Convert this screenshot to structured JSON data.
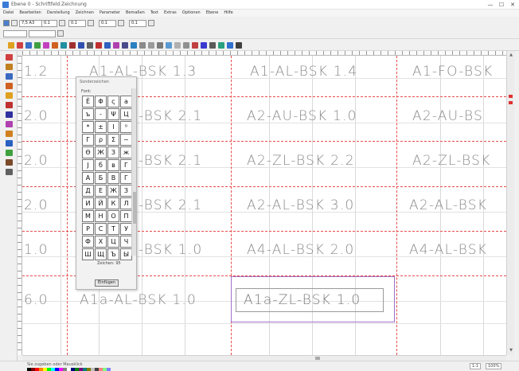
{
  "window": {
    "title": "Ebene 0 - Schriftfeld.Zeichnung",
    "controls": [
      "—",
      "☐",
      "✕"
    ]
  },
  "menu": [
    "Datei",
    "Bearbeiten",
    "Darstellung",
    "Zeichnen",
    "Parameter",
    "Bemaßen",
    "Text",
    "Extras",
    "Optionen",
    "Ebene",
    "Hilfe"
  ],
  "toolbar": {
    "layer_value": "7,5 A3",
    "fields": [
      "0.1",
      "0.1",
      "0.1",
      "0.1"
    ]
  },
  "canvas": {
    "rows": [
      {
        "c0": "1.2",
        "c1": "A1-AL-BSK 1.3",
        "c2": "A1-AL-BSK 1.4",
        "c3": "A1-FO-BSK"
      },
      {
        "c0": "2.0",
        "c1": "-BSK 2.1",
        "c2": "A2-AU-BSK 1.0",
        "c3": "A2-AU-BS"
      },
      {
        "c0": "2.0",
        "c1": "-BSK 2.1",
        "c2": "A2-ZL-BSK 2.2",
        "c3": "A2-ZL-BSK"
      },
      {
        "c0": "2.0",
        "c1": "-BSK 2.1",
        "c2": "A2-AL-BSK 3.0",
        "c3": "A2-AL-BSK"
      },
      {
        "c0": "1.0",
        "c1": "-BSK 1.0",
        "c2": "A4-AL-BSK 2.0",
        "c3": "A4-AL-BSK"
      },
      {
        "c0": "6.0",
        "c1": "A1a-AL-BSK 1.0",
        "c2": "A1a-ZL-BSK 1.0",
        "c3": ""
      }
    ],
    "selected_text": "A1a-ZL-BSK 1.0",
    "colors": {
      "grid_red": "#e74c4c",
      "selection": "#a070c8",
      "text": "#8a8a8a"
    }
  },
  "char_panel": {
    "title": "Sonderzeichen",
    "subtitle": "Font:",
    "chars": [
      "Ê",
      "Φ",
      "ς",
      "a",
      "ъ",
      "-",
      "Ψ",
      "Ц",
      "*",
      "±",
      "Ι",
      "⁰",
      "Γ",
      "ρ",
      "Σ",
      "~",
      "Θ",
      "Ж",
      "З",
      "ж",
      "Ј",
      "б",
      "в",
      "Г",
      "А",
      "Б",
      "В",
      "Г",
      "Д",
      "Е",
      "Ж",
      "З",
      "И",
      "Й",
      "К",
      "Л",
      "М",
      "Н",
      "О",
      "П",
      "Р",
      "С",
      "Т",
      "У",
      "Ф",
      "Х",
      "Ц",
      "Ч",
      "Ш",
      "Щ",
      "Ъ",
      "Ы"
    ],
    "count_label": "Zeichen: 95",
    "button_label": "Einfügen"
  },
  "status": {
    "hint": "Sie zugeben oder Mausklick",
    "scale": "1:1",
    "zoom": "100%"
  },
  "palette": [
    "#000000",
    "#7f0000",
    "#ff0000",
    "#ff7f00",
    "#ffff00",
    "#00ff00",
    "#00ffff",
    "#0000ff",
    "#ff00ff",
    "#7f7f7f",
    "#ffffff",
    "#00007f",
    "#007f00",
    "#7f007f",
    "#007f7f",
    "#7f7f00",
    "#c0c0c0",
    "#404040",
    "#ff8080",
    "#80ff80",
    "#8080ff"
  ]
}
